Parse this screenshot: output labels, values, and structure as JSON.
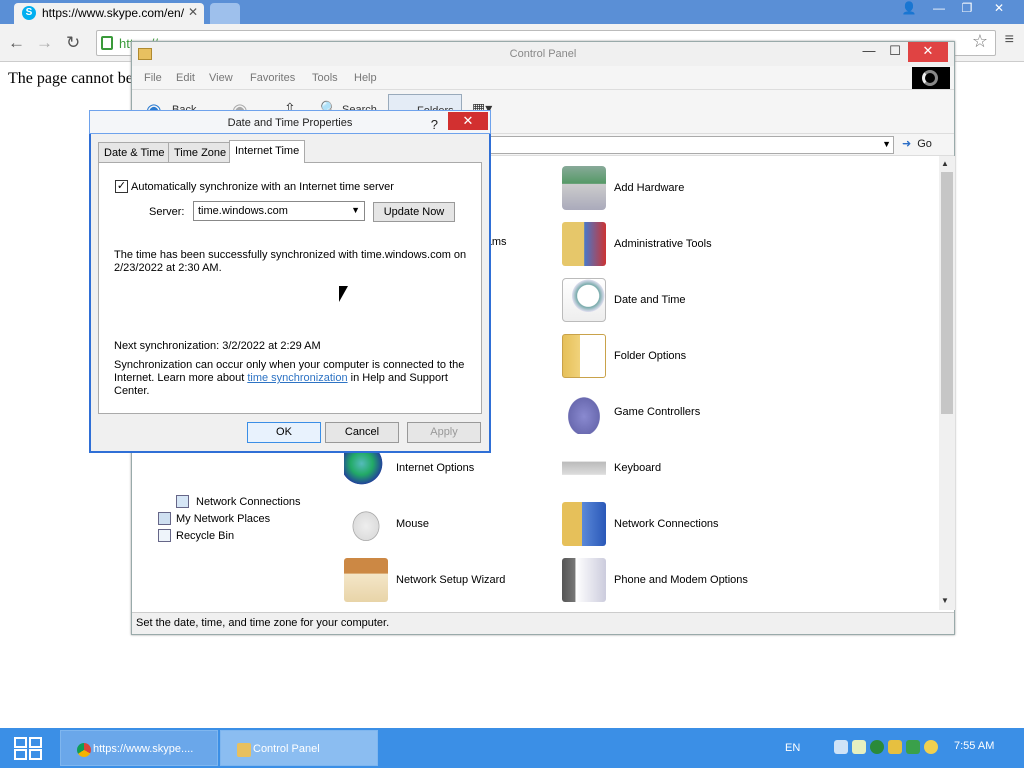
{
  "browser": {
    "tab_title": "https://www.skype.com/en/",
    "url": "https://",
    "page_text": "The page cannot be"
  },
  "control_panel": {
    "title": "Control Panel",
    "menu": [
      "File",
      "Edit",
      "View",
      "Favorites",
      "Tools",
      "Help"
    ],
    "toolbar": {
      "back": "Back",
      "search": "Search",
      "folders": "Folders"
    },
    "go_label": "Go",
    "left_links": [
      "Network Connections",
      "My Network Places",
      "Recycle Bin"
    ],
    "items": [
      {
        "label": "Add Hardware",
        "icon": "add-hardware-icon"
      },
      {
        "label": "Administrative Tools",
        "icon": "admin-tools-icon"
      },
      {
        "label": "Date and Time",
        "icon": "date-time-icon"
      },
      {
        "label": "Folder Options",
        "icon": "folder-options-icon"
      },
      {
        "label": "Game Controllers",
        "icon": "gamepad-icon"
      },
      {
        "label": "Internet Options",
        "icon": "internet-options-icon"
      },
      {
        "label": "Keyboard",
        "icon": "keyboard-icon"
      },
      {
        "label": "Mouse",
        "icon": "mouse-icon"
      },
      {
        "label": "Network Connections",
        "icon": "network-connections-icon"
      },
      {
        "label": "Network Setup Wizard",
        "icon": "network-wizard-icon"
      },
      {
        "label": "Phone and Modem Options",
        "icon": "phone-modem-icon"
      }
    ],
    "partial_labels": [
      "s",
      "grams"
    ],
    "status": "Set the date, time, and time zone for your computer."
  },
  "dialog": {
    "title": "Date and Time Properties",
    "tabs": [
      "Date & Time",
      "Time Zone",
      "Internet Time"
    ],
    "active_tab": "Internet Time",
    "auto_sync_label": "Automatically synchronize with an Internet time server",
    "auto_sync_checked": true,
    "server_label": "Server:",
    "server_value": "time.windows.com",
    "update_button": "Update Now",
    "sync_message": "The time has been successfully synchronized with time.windows.com on 2/23/2022 at 2:30 AM.",
    "next_sync": "Next synchronization: 3/2/2022 at 2:29 AM",
    "note_before": "Synchronization can occur only when your computer is connected to the Internet.  Learn more about ",
    "note_link": "time synchronization",
    "note_after": " in Help and Support Center.",
    "ok": "OK",
    "cancel": "Cancel",
    "apply": "Apply"
  },
  "taskbar": {
    "tasks": [
      "https://www.skype....",
      "Control Panel"
    ],
    "lang": "EN",
    "clock": "7:55 AM"
  }
}
